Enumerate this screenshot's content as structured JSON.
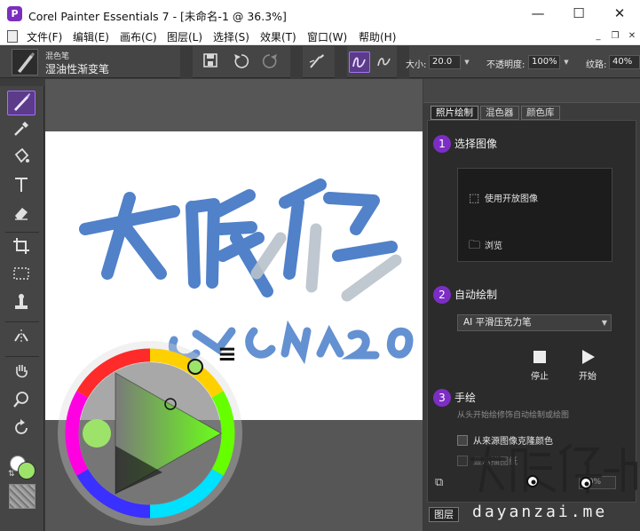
{
  "window": {
    "app_icon": "P",
    "title": "Corel Painter Essentials 7 - [未命名-1 @ 36.3%]",
    "minimize": "—",
    "maximize": "☐",
    "close": "✕"
  },
  "menu": {
    "items": [
      "文件(F)",
      "编辑(E)",
      "画布(C)",
      "图层(L)",
      "选择(S)",
      "效果(T)",
      "窗口(W)",
      "帮助(H)"
    ],
    "mdi_minimize": "_",
    "mdi_restore": "❐",
    "mdi_close": "✕"
  },
  "property_bar": {
    "brush_category": "混色笔",
    "brush_variant": "湿油性渐变笔",
    "size_label": "大小:",
    "size_value": "20.0",
    "opacity_label": "不透明度:",
    "opacity_value": "100%",
    "grain_label": "纹路:",
    "grain_value": "40%",
    "icons": [
      "save-icon",
      "undo-icon",
      "redo-icon",
      "brush-tracking-icon",
      "stroke-style-icon",
      "stroke-style-2-icon"
    ]
  },
  "toolbox": {
    "tools": [
      "brush-tool-icon",
      "dropper-tool-icon",
      "paint-bucket-icon",
      "text-tool-icon",
      "eraser-icon",
      "crop-icon",
      "rectangle-select-icon",
      "clone-stamp-icon",
      "symmetry-icon",
      "grabber-hand-icon",
      "magnifier-icon",
      "rotate-page-icon"
    ],
    "main_color": "#ffffff",
    "add_color": "#9de36a",
    "swap": "⇅"
  },
  "canvas": {
    "background": "#ffffff",
    "stroke_color": "#3e74c4",
    "blend_color": "#b9c2cb"
  },
  "color_wheel": {
    "selected_color": "#9de36a",
    "menu_icon": "≡"
  },
  "panel": {
    "tabs": [
      "照片绘制",
      "混色器",
      "颜色库"
    ],
    "active_tab": 0,
    "step1": {
      "num": "1",
      "title": "选择图像",
      "use_open_image": "使用开放图像",
      "browse": "浏览"
    },
    "step2": {
      "num": "2",
      "title": "自动绘制",
      "style_select": "AI 平滑压克力笔",
      "stop": "停止",
      "start": "开始"
    },
    "step3": {
      "num": "3",
      "title": "手绘",
      "hint": "从头开始绘修饰自动绘制或绘图",
      "clone_color": "从来源图像克隆颜色",
      "tracing_paper": "显示描图纸",
      "opacity": "50%"
    },
    "layers_tab": "图层"
  },
  "watermark": {
    "line1": "大眼仔-旭",
    "line2": "dayanzai.me"
  }
}
